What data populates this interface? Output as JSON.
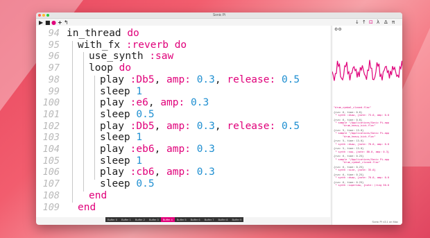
{
  "window": {
    "title": "Sonic Pi"
  },
  "toolbar_right": [
    "↓",
    "↑",
    "⊡",
    "λ",
    "Δ",
    "π"
  ],
  "editor": {
    "lines": [
      {
        "n": "94",
        "indent": 0,
        "tokens": [
          [
            "fn",
            "in_thread "
          ],
          [
            "kw",
            "do"
          ]
        ]
      },
      {
        "n": "95",
        "indent": 1,
        "tokens": [
          [
            "fn",
            "with_fx "
          ],
          [
            "sym",
            ":reverb"
          ],
          [
            "fn",
            " "
          ],
          [
            "kw",
            "do"
          ]
        ]
      },
      {
        "n": "96",
        "indent": 2,
        "tokens": [
          [
            "fn",
            "use_synth "
          ],
          [
            "sym",
            ":saw"
          ]
        ]
      },
      {
        "n": "97",
        "indent": 2,
        "tokens": [
          [
            "fn",
            "loop "
          ],
          [
            "kw",
            "do"
          ]
        ]
      },
      {
        "n": "98",
        "indent": 3,
        "tokens": [
          [
            "fn",
            "play "
          ],
          [
            "sym",
            ":Db5"
          ],
          [
            "fn",
            ", "
          ],
          [
            "sym",
            "amp:"
          ],
          [
            "fn",
            " "
          ],
          [
            "num",
            "0.3"
          ],
          [
            "fn",
            ", "
          ],
          [
            "sym",
            "release:"
          ],
          [
            "fn",
            " "
          ],
          [
            "num",
            "0.5"
          ]
        ]
      },
      {
        "n": "99",
        "indent": 3,
        "tokens": [
          [
            "fn",
            "sleep "
          ],
          [
            "num",
            "1"
          ]
        ]
      },
      {
        "n": "100",
        "indent": 3,
        "tokens": [
          [
            "fn",
            "play "
          ],
          [
            "sym",
            ":e6"
          ],
          [
            "fn",
            ", "
          ],
          [
            "sym",
            "amp:"
          ],
          [
            "fn",
            " "
          ],
          [
            "num",
            "0.3"
          ]
        ]
      },
      {
        "n": "101",
        "indent": 3,
        "tokens": [
          [
            "fn",
            "sleep "
          ],
          [
            "num",
            "0.5"
          ]
        ]
      },
      {
        "n": "102",
        "indent": 3,
        "tokens": [
          [
            "fn",
            "play "
          ],
          [
            "sym",
            ":Db5"
          ],
          [
            "fn",
            ", "
          ],
          [
            "sym",
            "amp:"
          ],
          [
            "fn",
            " "
          ],
          [
            "num",
            "0.3"
          ],
          [
            "fn",
            ", "
          ],
          [
            "sym",
            "release:"
          ],
          [
            "fn",
            " "
          ],
          [
            "num",
            "0.5"
          ]
        ]
      },
      {
        "n": "103",
        "indent": 3,
        "tokens": [
          [
            "fn",
            "sleep "
          ],
          [
            "num",
            "1"
          ]
        ]
      },
      {
        "n": "104",
        "indent": 3,
        "tokens": [
          [
            "fn",
            "play "
          ],
          [
            "sym",
            ":eb6"
          ],
          [
            "fn",
            ", "
          ],
          [
            "sym",
            "amp:"
          ],
          [
            "fn",
            " "
          ],
          [
            "num",
            "0.3"
          ]
        ]
      },
      {
        "n": "105",
        "indent": 3,
        "tokens": [
          [
            "fn",
            "sleep "
          ],
          [
            "num",
            "1"
          ]
        ]
      },
      {
        "n": "106",
        "indent": 3,
        "tokens": [
          [
            "fn",
            "play "
          ],
          [
            "sym",
            ":cb6"
          ],
          [
            "fn",
            ", "
          ],
          [
            "sym",
            "amp:"
          ],
          [
            "fn",
            " "
          ],
          [
            "num",
            "0.3"
          ]
        ]
      },
      {
        "n": "107",
        "indent": 3,
        "tokens": [
          [
            "fn",
            "sleep "
          ],
          [
            "num",
            "0.5"
          ]
        ]
      },
      {
        "n": "108",
        "indent": 2,
        "tokens": [
          [
            "kw",
            "end"
          ]
        ]
      },
      {
        "n": "109",
        "indent": 1,
        "tokens": [
          [
            "kw",
            "end"
          ]
        ]
      }
    ]
  },
  "log": [
    {
      "head": "",
      "body": "\"drum_cymbal_closed.flac\""
    },
    {
      "head": "{run: 6, time: 0.0}",
      "body": " └ synth :dsaw, {note: 73.0, amp: 0.0"
    },
    {
      "head": "{run: 6, time: 0.0}",
      "body": " └ sample \"/Applications/Sonic Pi.app\n      \"drum_heavy_kick.flac\""
    },
    {
      "head": "{run: 5, time: 13.0}",
      "body": " └ sample \"/Applications/Sonic Pi.app\n      \"drum_heavy_kick.flac\""
    },
    {
      "head": "{run: 5, time: 13.0}",
      "body": " └ synth :dsaw, {note: 70.0, amp: 0.0"
    },
    {
      "head": "{run: 5, time: 13.0}",
      "body": " └ synth :saw, {note: 80.0, amp: 0.3}"
    },
    {
      "head": "{run: 6, time: 0.25}",
      "body": " └ sample \"/Applications/Sonic Pi.app\n      \"drum_cymbal_closed.flac\""
    },
    {
      "head": "{run: 6, time: 0.25}",
      "body": " └ synth :sine, {note: 35.0}"
    },
    {
      "head": "{run: 6, time: 0.25}",
      "body": " └ synth :dsaw, {note: 70.0, amp: 0.0"
    },
    {
      "head": "{run: 6, time: 0.25}",
      "body": " └ synth :supersaw, {note: (ring 50.0"
    }
  ],
  "tabs": [
    "Buffer 0",
    "Buffer 1",
    "Buffer 2",
    "Buffer 3",
    "Buffer 4",
    "Buffer 5",
    "Buffer 6",
    "Buffer 7",
    "Buffer 8",
    "Buffer 9"
  ],
  "active_tab": 4,
  "status": "Sonic Pi v3.1 on Mac",
  "colors": {
    "keyword": "#e0007a",
    "number": "#1f8fd1",
    "scope": "#e0007a"
  }
}
